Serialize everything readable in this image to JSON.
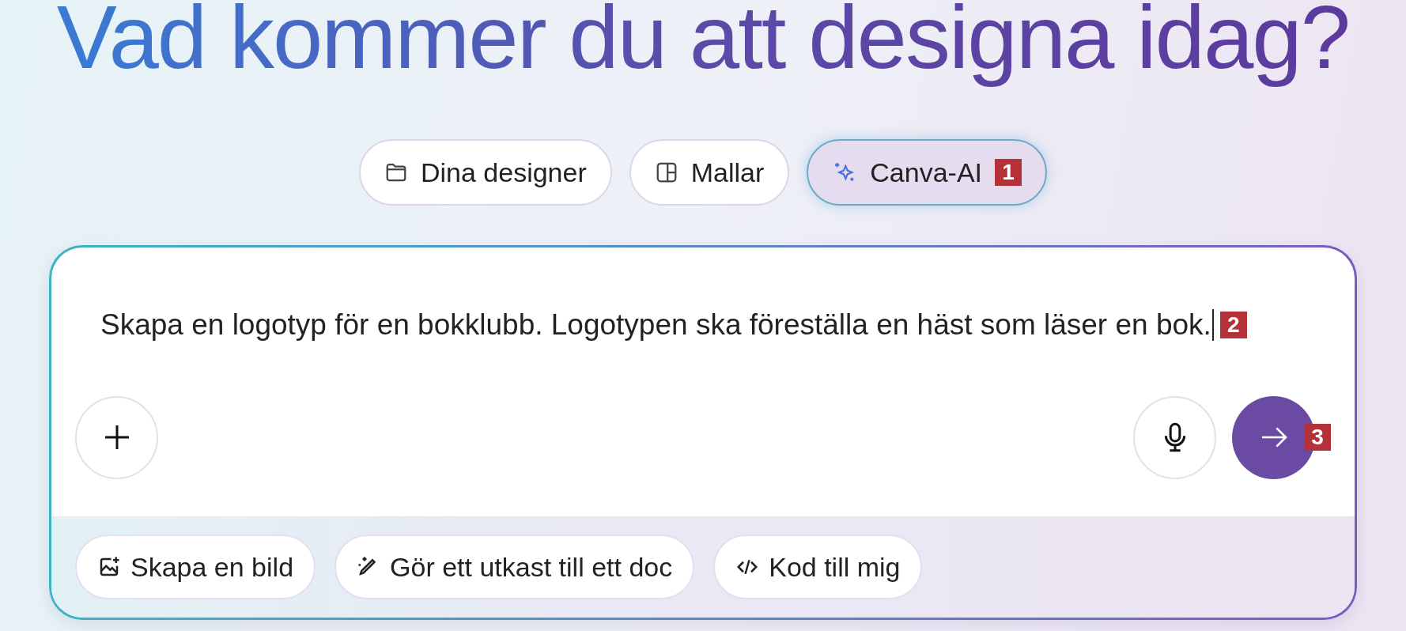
{
  "heading": "Vad kommer du att designa idag?",
  "tabs": [
    {
      "label": "Dina designer",
      "kind": "folder",
      "selected": false
    },
    {
      "label": "Mallar",
      "kind": "template",
      "selected": false
    },
    {
      "label": "Canva-AI",
      "kind": "sparkle",
      "selected": true,
      "badge": "1"
    }
  ],
  "prompt": {
    "value": "Skapa en logotyp för en bokklubb. Logotypen ska föreställa en häst som läser en bok.",
    "badge": "2"
  },
  "send_badge": "3",
  "suggestions": [
    {
      "label": "Skapa en bild",
      "kind": "image"
    },
    {
      "label": "Gör ett utkast till ett doc",
      "kind": "pen"
    },
    {
      "label": "Kod till mig",
      "kind": "code"
    }
  ]
}
